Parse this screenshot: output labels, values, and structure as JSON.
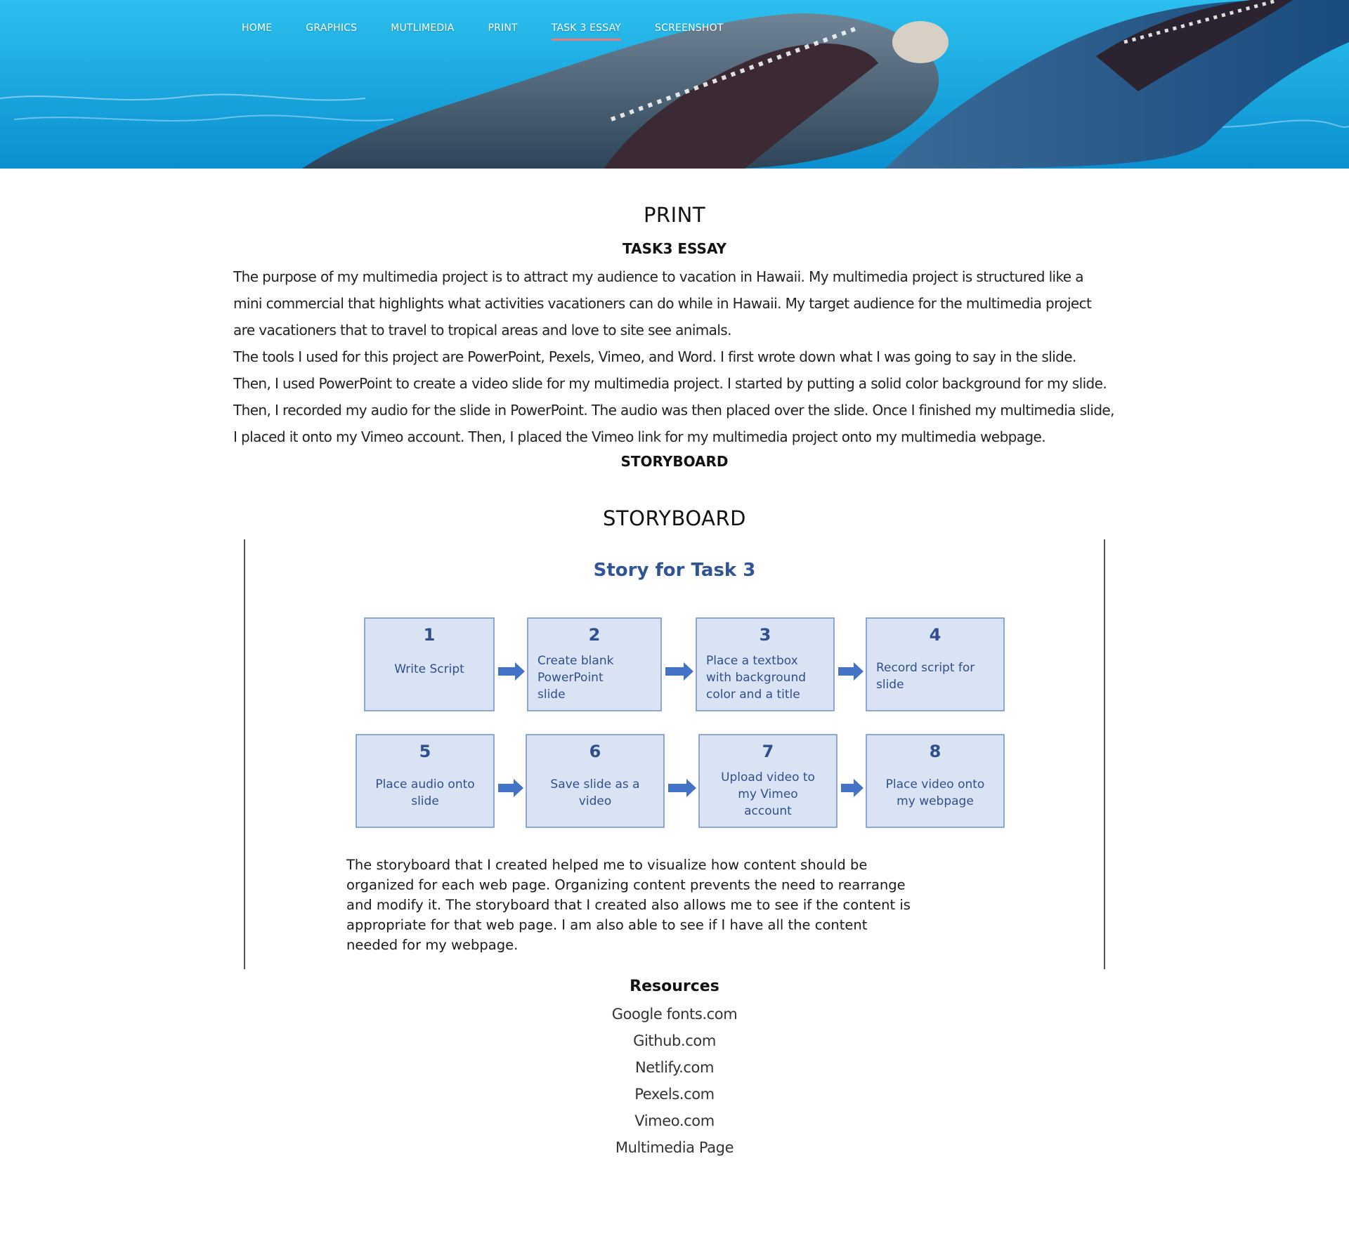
{
  "nav": {
    "items": [
      {
        "label": "HOME",
        "active": false
      },
      {
        "label": "GRAPHICS",
        "active": false
      },
      {
        "label": "MUTLIMEDIA",
        "active": false
      },
      {
        "label": "PRINT",
        "active": false
      },
      {
        "label": "TASK 3 ESSAY",
        "active": true
      },
      {
        "label": "SCREENSHOT",
        "active": false
      }
    ],
    "active_underline_color": "#f07a7a"
  },
  "print_section": {
    "title": "PRINT",
    "essay_heading": "TASK3 ESSAY",
    "paragraphs": [
      "The purpose of my multimedia project is to attract my audience to vacation in Hawaii. My multimedia project is structured like a mini commercial that highlights what activities vacationers can do while in Hawaii. My target audience for the multimedia project are vacationers that to travel to tropical areas and love to site see animals.",
      "The tools I used for this project are PowerPoint, Pexels, Vimeo, and Word. I first wrote down what I was going to say in the slide. Then, I used PowerPoint to create a video slide for my multimedia project. I started by putting a solid color background for my slide. Then, I recorded my audio for the slide in PowerPoint. The audio was then placed over the slide. Once I finished my multimedia slide, I placed it onto my Vimeo account. Then, I placed the Vimeo link for my multimedia project onto my multimedia webpage."
    ],
    "storyboard_label": "STORYBOARD"
  },
  "storyboard_section": {
    "title": "STORYBOARD",
    "image": {
      "heading": "Story for Task 3",
      "steps": [
        {
          "number": "1",
          "lines": [
            "Write Script"
          ]
        },
        {
          "number": "2",
          "lines": [
            "Create blank",
            "PowerPoint",
            "slide"
          ]
        },
        {
          "number": "3",
          "lines": [
            "Place a textbox",
            "with background",
            "color and a title"
          ]
        },
        {
          "number": "4",
          "lines": [
            "Record script for",
            "slide"
          ]
        },
        {
          "number": "5",
          "lines": [
            "Place audio onto",
            "slide"
          ]
        },
        {
          "number": "6",
          "lines": [
            "Save slide as a",
            "video"
          ]
        },
        {
          "number": "7",
          "lines": [
            "Upload video to",
            "my Vimeo",
            "account"
          ]
        },
        {
          "number": "8",
          "lines": [
            "Place video onto",
            "my webpage"
          ]
        }
      ],
      "description_lines": [
        "The storyboard that I created helped me to visualize how content should be",
        "organized for each web page. Organizing content prevents the need to rearrange",
        "and modify it. The storyboard that I created also allows me to see if the content is",
        "appropriate for that web page. I am also able to see if I have all the content",
        "needed for my webpage."
      ],
      "colors": {
        "heading": "#2f5597",
        "box_fill": "#dae3f3",
        "box_border": "#6f8fc7",
        "arrow": "#4472c4",
        "box_text": "#2f4f8f"
      }
    }
  },
  "resources": {
    "heading": "Resources",
    "links": [
      "Google fonts.com",
      "Github.com",
      "Netlify.com",
      "Pexels.com",
      "Vimeo.com",
      "Multimedia Page"
    ]
  }
}
